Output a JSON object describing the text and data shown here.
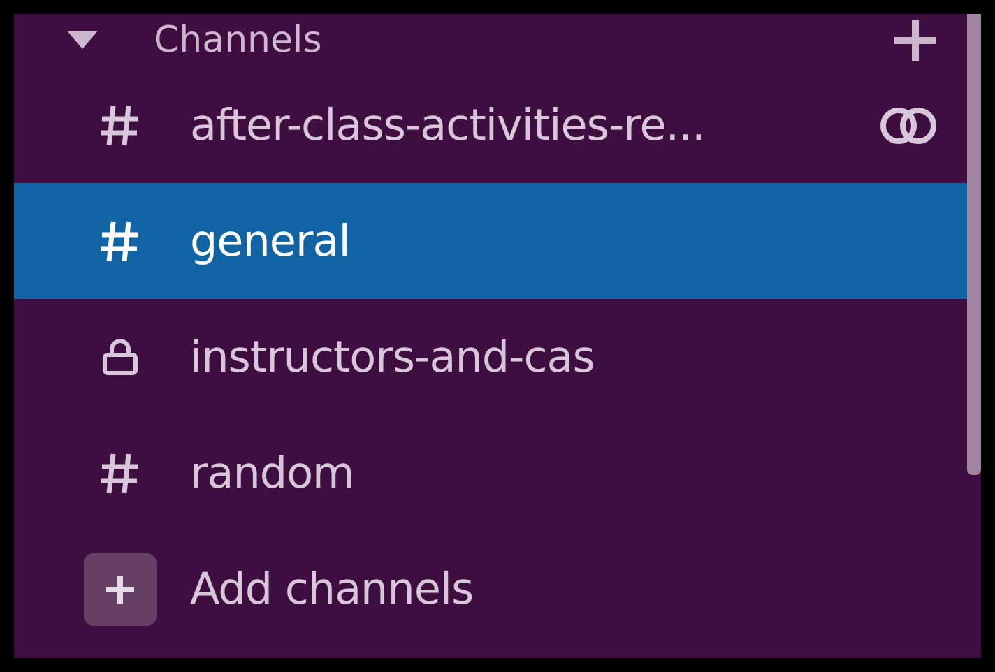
{
  "section": {
    "title": "Channels",
    "expanded": true
  },
  "channels": [
    {
      "kind": "public",
      "name": "after-class-activities-re...",
      "shared": true,
      "selected": false
    },
    {
      "kind": "public",
      "name": "general",
      "shared": false,
      "selected": true
    },
    {
      "kind": "private",
      "name": "instructors-and-cas",
      "shared": false,
      "selected": false
    },
    {
      "kind": "public",
      "name": "random",
      "shared": false,
      "selected": false
    },
    {
      "kind": "add",
      "name": "Add channels",
      "shared": false,
      "selected": false
    }
  ]
}
